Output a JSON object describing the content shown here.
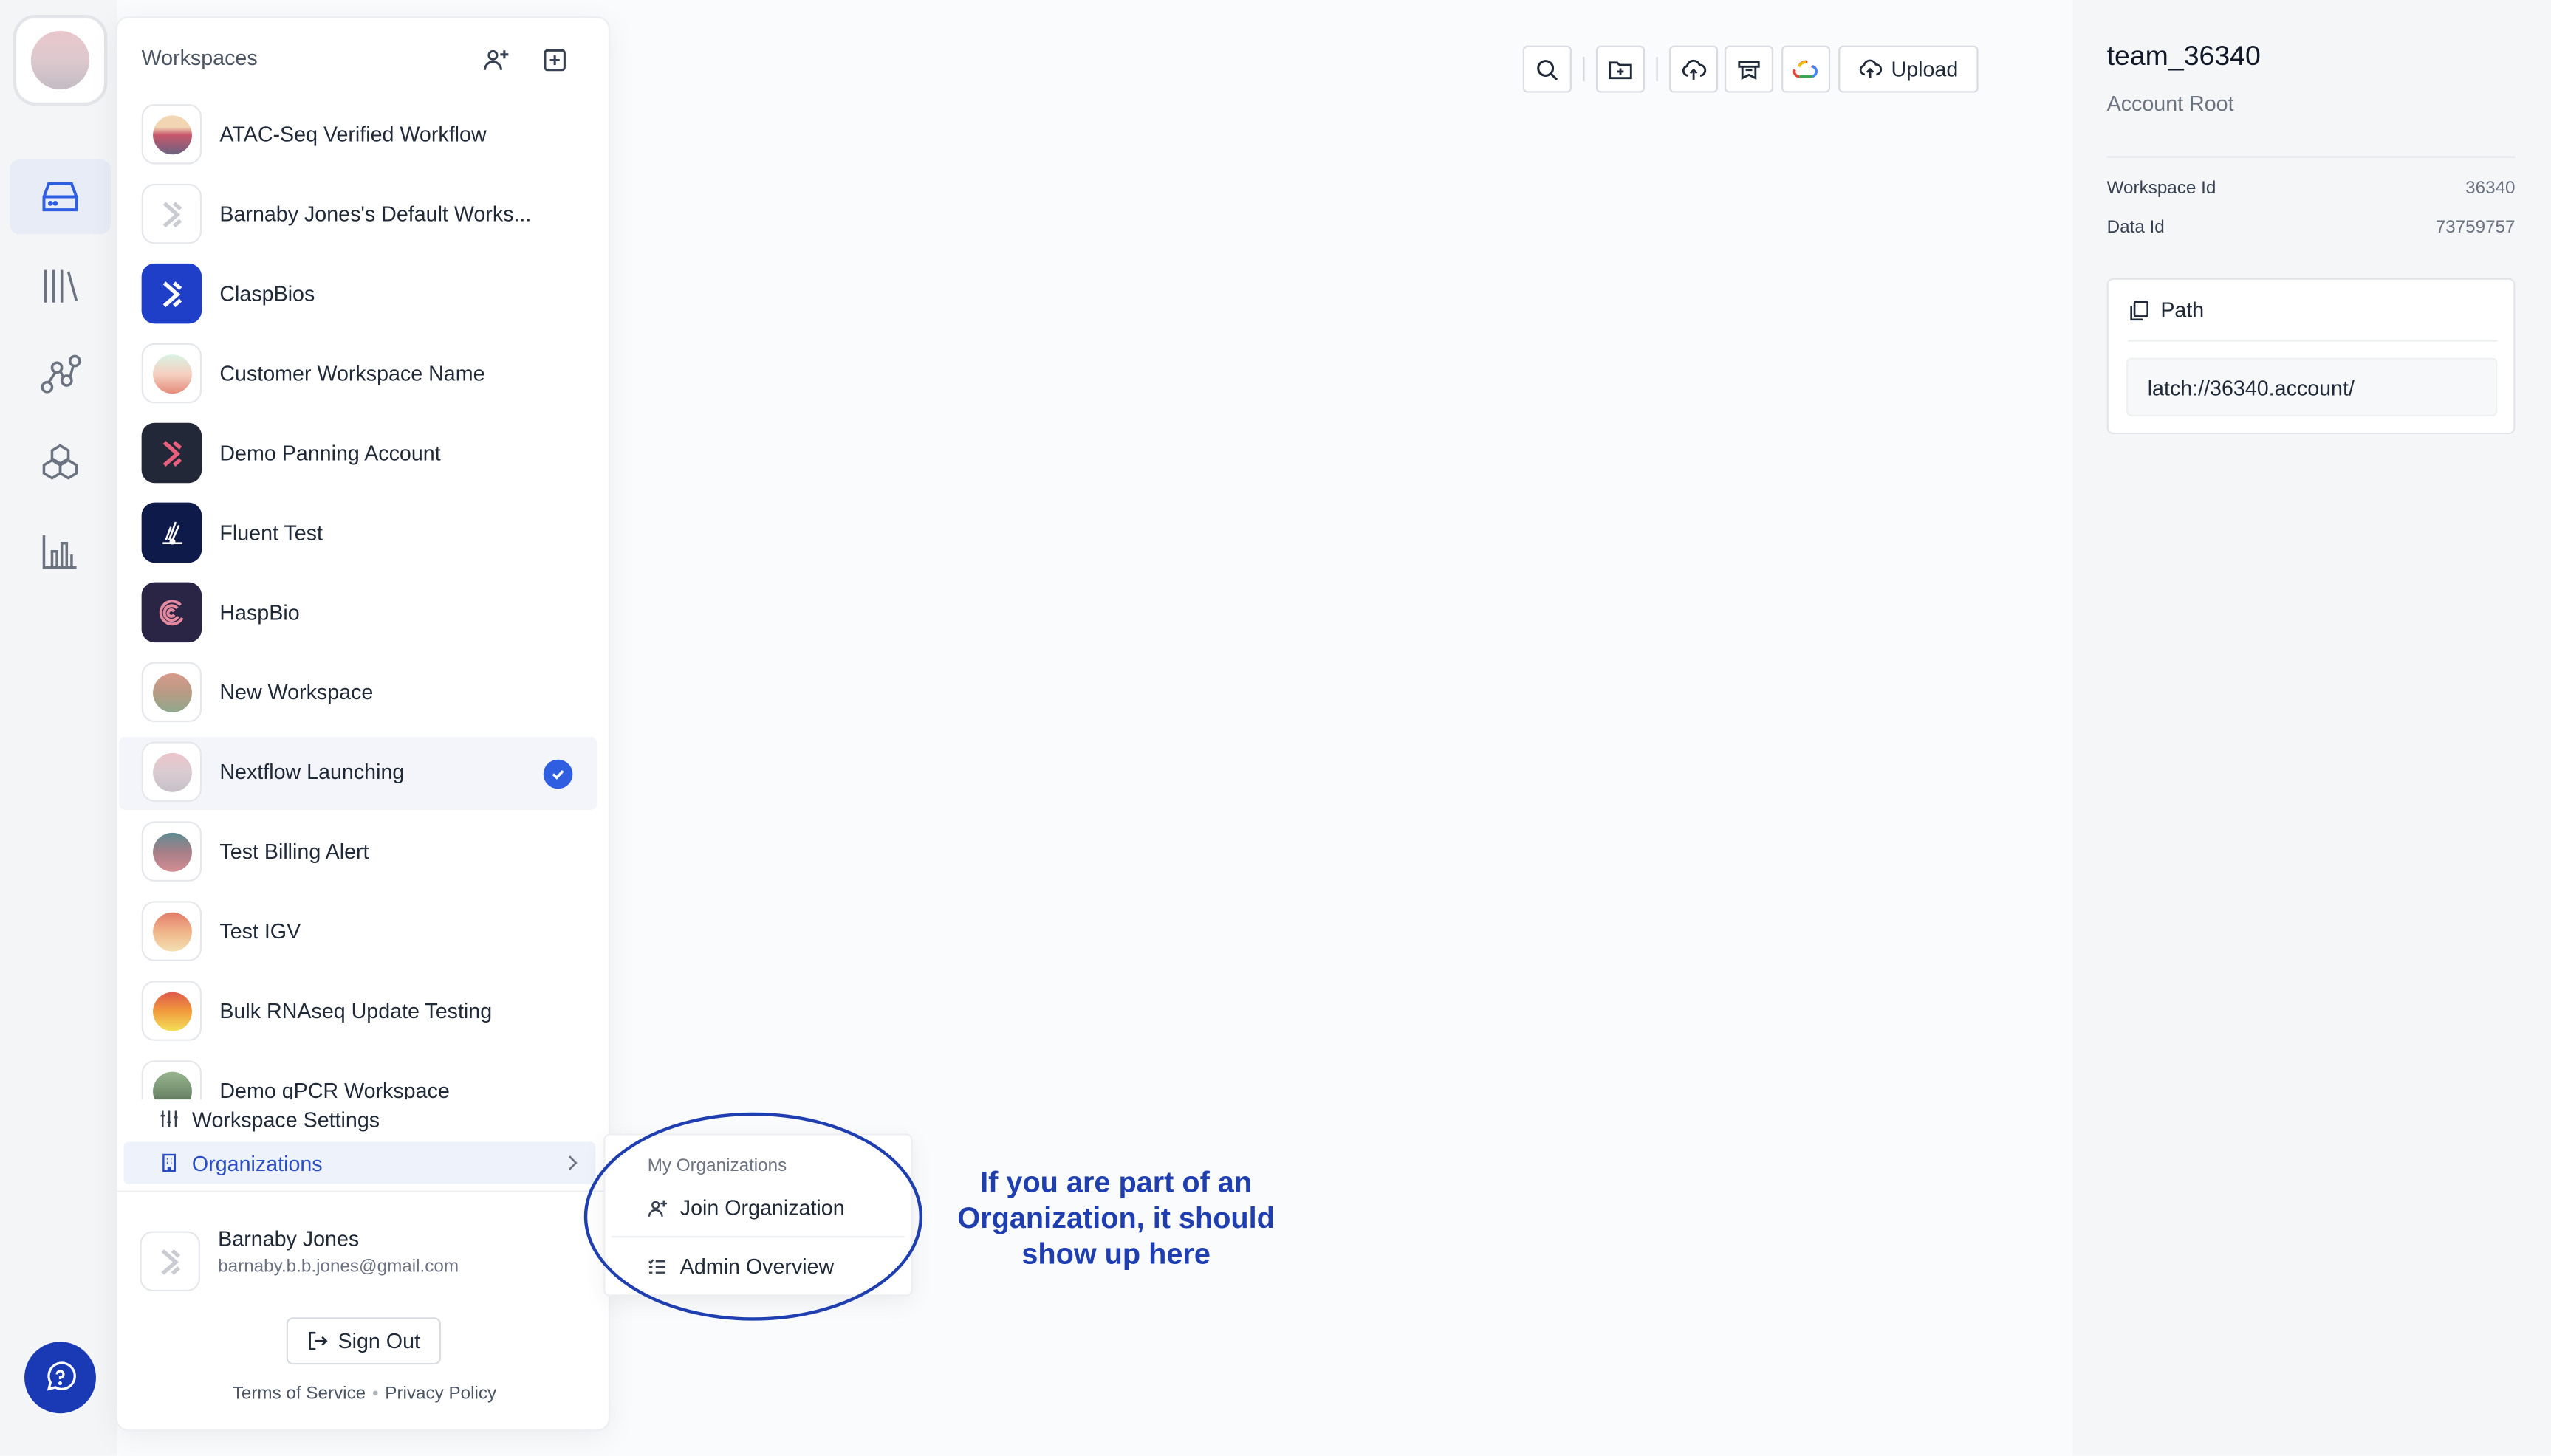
{
  "panel": {
    "title": "Workspaces",
    "icons": [
      "add-member-icon",
      "add-workspace-icon"
    ],
    "workspaces": [
      {
        "name": "ATAC-Seq Verified Workflow",
        "avatar": "gradient",
        "colors": [
          "#f2d6b3",
          "#c7566c",
          "#6a6380"
        ]
      },
      {
        "name": "Barnaby Jones's Default Works...",
        "avatar": "logo-light"
      },
      {
        "name": "ClaspBios",
        "avatar": "logo-blue"
      },
      {
        "name": "Customer Workspace Name",
        "avatar": "gradient",
        "colors": [
          "#d9f3e3",
          "#f4d0c1",
          "#e58c7b"
        ]
      },
      {
        "name": "Demo Panning Account",
        "avatar": "logo-dark"
      },
      {
        "name": "Fluent Test",
        "avatar": "logo-navy"
      },
      {
        "name": "HaspBio",
        "avatar": "logo-purple"
      },
      {
        "name": "New Workspace",
        "avatar": "gradient",
        "colors": [
          "#d89a8a",
          "#b79b85",
          "#8fa88c"
        ]
      },
      {
        "name": "Nextflow Launching",
        "avatar": "gradient",
        "colors": [
          "#ecc5cb",
          "#d9ccd1",
          "#c7bfc8"
        ],
        "selected": true
      },
      {
        "name": "Test Billing Alert",
        "avatar": "gradient",
        "colors": [
          "#5f8b92",
          "#a77f88",
          "#d38d93"
        ]
      },
      {
        "name": "Test IGV",
        "avatar": "gradient",
        "colors": [
          "#e27c6a",
          "#f0b58a",
          "#f3e0b3"
        ]
      },
      {
        "name": "Bulk RNAseq Update Testing",
        "avatar": "gradient",
        "colors": [
          "#df5a4c",
          "#f19c3d",
          "#f4e05b"
        ]
      },
      {
        "name": "Demo qPCR Workspace",
        "avatar": "gradient",
        "colors": [
          "#98b48f",
          "#6f8a6b",
          "#3d4a3c"
        ]
      }
    ],
    "workspace_settings": "Workspace Settings",
    "organizations": "Organizations",
    "user": {
      "name": "Barnaby Jones",
      "email": "barnaby.b.b.jones@gmail.com"
    },
    "sign_out": "Sign Out",
    "terms": "Terms of Service",
    "privacy": "Privacy Policy",
    "footer_sep": "•"
  },
  "submenu": {
    "heading": "My Organizations",
    "join": "Join Organization",
    "admin": "Admin Overview"
  },
  "annotation": {
    "line1": "If you are part of an",
    "line2": "Organization, it should",
    "line3": "show up here"
  },
  "toolbar": {
    "icons": [
      "search-icon",
      "new-folder-icon",
      "cloud-upload-icon",
      "registry-icon",
      "google-cloud-icon"
    ],
    "upload": "Upload"
  },
  "sidebar": {
    "title": "team_36340",
    "subtitle": "Account Root",
    "workspace_id_label": "Workspace Id",
    "workspace_id": "36340",
    "data_id_label": "Data Id",
    "data_id": "73759757",
    "path_label": "Path",
    "path_value": "latch://36340.account/"
  },
  "rail": {
    "items": [
      "data-icon",
      "library-icon",
      "workflows-icon",
      "registry-icon",
      "analytics-icon"
    ],
    "help": "help-icon"
  },
  "colors": {
    "accent": "#2f5fe0",
    "annotation": "#1f3fb0",
    "help": "#1a3ab5"
  }
}
